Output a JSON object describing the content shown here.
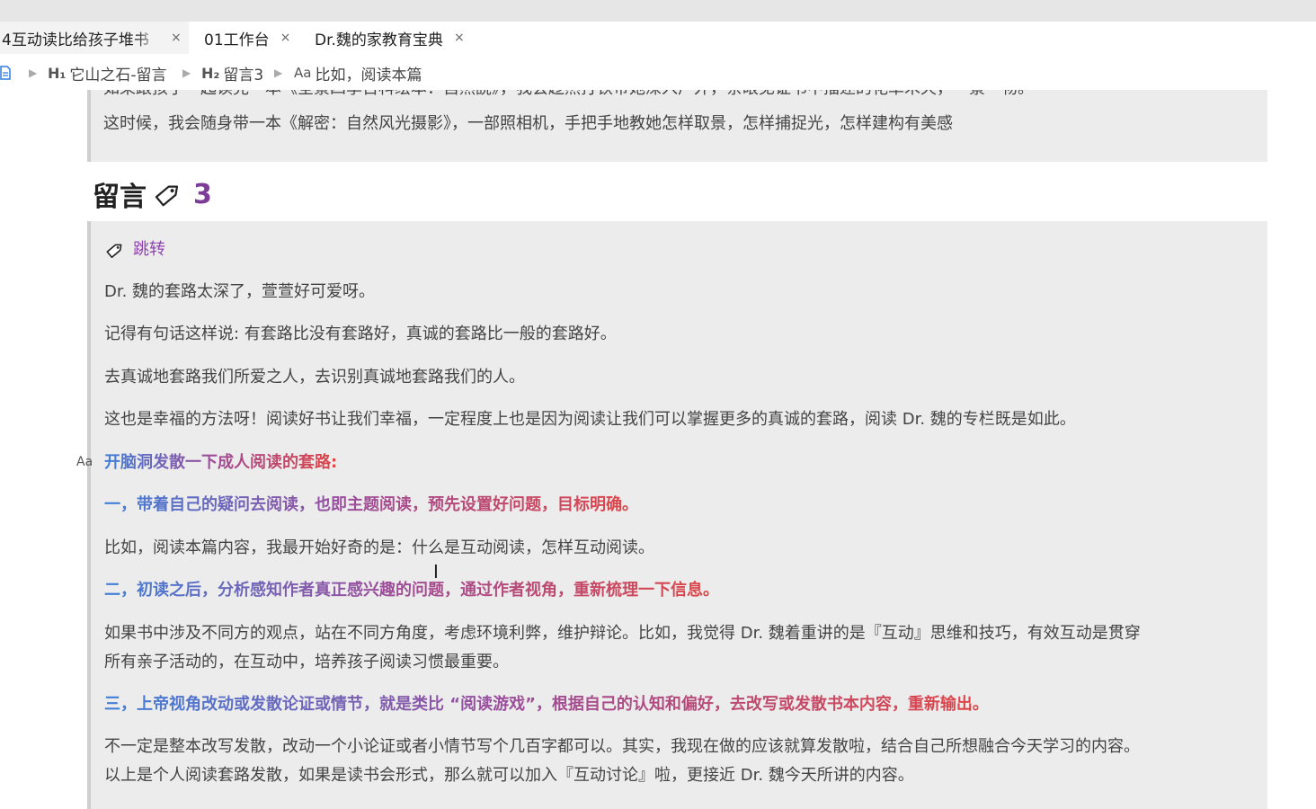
{
  "tabs": [
    {
      "label": "4互动读比给孩子堆书",
      "close": "×"
    },
    {
      "label": "01工作台",
      "close": "×"
    },
    {
      "label": "Dr.魏的家教育宝典",
      "close": "×"
    }
  ],
  "breadcrumb": {
    "items": [
      {
        "mark": "H₁",
        "label": "它山之石-留言"
      },
      {
        "mark": "H₂",
        "label": "留言3"
      },
      {
        "mark": "Aa",
        "label": "比如，阅读本篇"
      }
    ]
  },
  "quote_top": {
    "line1": "如果跟孩子一起读完一本《全景四季百科绘本：自然說》，我会趁然打铁带她深入户外，亲眼见证书中描述的花草禾天，一景一物。",
    "line2": "这时候，我会随身带一本《解密：自然风光摄影》，一部照相机，手把手地教她怎样取景，怎样捕捉光，怎样建构有美感"
  },
  "heading": {
    "text": "留言",
    "icon": "tag-icon",
    "number": "3"
  },
  "comment": {
    "jump_label": "跳转",
    "p1": "Dr. 魏的套路太深了，萱萱好可爱呀。",
    "p2": " 记得有句话这样说: 有套路比没有套路好，真诚的套路比一般的套路好。",
    "p3": "去真诚地套路我们所爱之人，去识别真诚地套路我们的人。",
    "p4": "这也是幸福的方法呀！阅读好书让我们幸福，一定程度上也是因为阅读让我们可以掌握更多的真诚的套路，阅读 Dr. 魏的专栏既是如此。",
    "h_open": "开脑洞发散一下成人阅读的套路:",
    "h1": "一，带着自己的疑问去阅读，也即主题阅读，预先设置好问题，目标明确。",
    "p5": "比如，阅读本篇内容，我最开始好奇的是：什么是互动阅读，怎样互动阅读。",
    "h2": "二，初读之后，分析感知作者真正感兴趣的问题，通过作者视角，重新梳理一下信息。",
    "p6a": "如果书中涉及不同方的观点，站在不同方角度，考虑环境利弊，维护辩论。比如，我觉得 Dr. 魏着重讲的是『互动』思维和技巧，有效互动是贯穿",
    "p6b": "所有亲子活动的，在互动中，培养孩子阅读习惯最重要。",
    "h3": "三，上帝视角改动或发散论证或情节，就是类比 “阅读游戏”，根据自己的认知和偏好，去改写或发散书本内容，重新输出。",
    "p7a": "不一定是整本改写发散，改动一个小论证或者小情节写个几百字都可以。其实，我现在做的应该就算发散啦，结合自己所想融合今天学习的内容。",
    "p7b": "以上是个人阅读套路发散，如果是读书会形式，那么就可以加入『互动讨论』啦，更接近 Dr. 魏今天所讲的内容。"
  },
  "side_marker": "Aa"
}
